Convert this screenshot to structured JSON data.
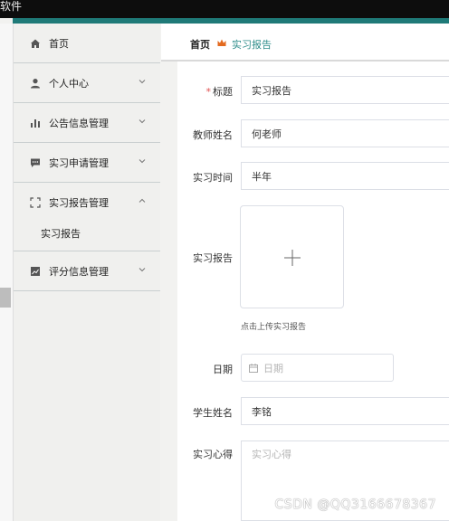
{
  "app": {
    "title": "软件"
  },
  "sidebar": {
    "items": [
      {
        "label": "首页",
        "icon": "home-icon",
        "expanded": null
      },
      {
        "label": "个人中心",
        "icon": "user-icon",
        "expanded": false
      },
      {
        "label": "公告信息管理",
        "icon": "bar-chart-icon",
        "expanded": false
      },
      {
        "label": "实习申请管理",
        "icon": "chat-icon",
        "expanded": false
      },
      {
        "label": "实习报告管理",
        "icon": "scan-icon",
        "expanded": true
      },
      {
        "label": "评分信息管理",
        "icon": "line-chart-icon",
        "expanded": false
      }
    ],
    "subitem": {
      "label": "实习报告"
    }
  },
  "breadcrumb": {
    "home": "首页",
    "current": "实习报告",
    "separator_icon": "crown-icon"
  },
  "form": {
    "title": {
      "label": "标题",
      "required_mark": "*",
      "value": "实习报告"
    },
    "teacher": {
      "label": "教师姓名",
      "value": "何老师"
    },
    "duration": {
      "label": "实习时间",
      "value": "半年"
    },
    "report": {
      "label": "实习报告",
      "hint": "点击上传实习报告",
      "icon": "plus-icon"
    },
    "date": {
      "label": "日期",
      "placeholder": "日期",
      "icon": "calendar-icon"
    },
    "student": {
      "label": "学生姓名",
      "value": "李铭"
    },
    "reflection": {
      "label": "实习心得",
      "placeholder": "实习心得"
    }
  },
  "watermark": "CSDN @QQ3166678367",
  "colors": {
    "accent": "#2d8c8a",
    "topbar": "#0d0d0d",
    "teal_strip": "#1f7a78",
    "required": "#e05050"
  }
}
